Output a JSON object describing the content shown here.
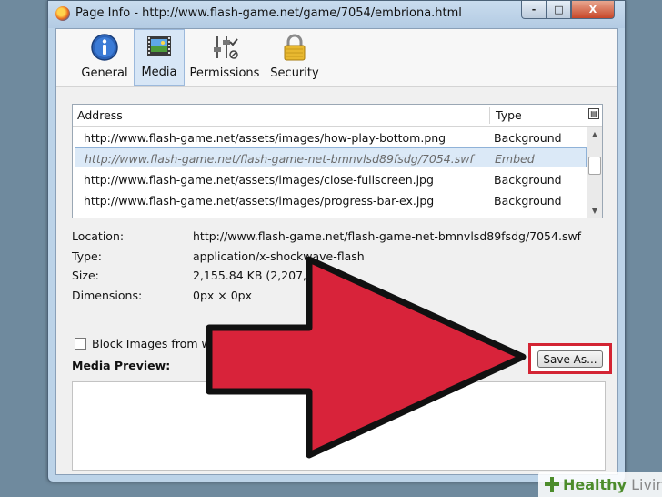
{
  "window": {
    "title": "Page Info - http://www.flash-game.net/game/7054/embriona.html",
    "controls": {
      "minimize": "-",
      "maximize": "□",
      "close": "X"
    }
  },
  "tabs": [
    {
      "label": "General",
      "icon": "info-icon"
    },
    {
      "label": "Media",
      "icon": "media-icon",
      "active": true
    },
    {
      "label": "Permissions",
      "icon": "permissions-icon"
    },
    {
      "label": "Security",
      "icon": "lock-icon"
    }
  ],
  "media_list": {
    "columns": {
      "address": "Address",
      "type": "Type"
    },
    "rows": [
      {
        "address": "http://www.flash-game.net/assets/images/how-play-bottom.png",
        "type": "Background"
      },
      {
        "address": "http://www.flash-game.net/flash-game-net-bmnvlsd89fsdg/7054.swf",
        "type": "Embed",
        "selected": true
      },
      {
        "address": "http://www.flash-game.net/assets/images/close-fullscreen.jpg",
        "type": "Background"
      },
      {
        "address": "http://www.flash-game.net/assets/images/progress-bar-ex.jpg",
        "type": "Background"
      }
    ]
  },
  "details": {
    "location": {
      "label": "Location:",
      "value": "http://www.flash-game.net/flash-game-net-bmnvlsd89fsdg/7054.swf"
    },
    "type": {
      "label": "Type:",
      "value": "application/x-shockwave-flash"
    },
    "size": {
      "label": "Size:",
      "value": "2,155.84 KB (2,207,57"
    },
    "dimensions": {
      "label": "Dimensions:",
      "value": "0px × 0px"
    }
  },
  "block_images": {
    "label": "Block Images from ww",
    "checked": false
  },
  "media_preview": {
    "label": "Media Preview:"
  },
  "save_button": {
    "label": "Save As..."
  },
  "annotation": {
    "arrow_color": "#d8233a",
    "highlight_color": "#d32433"
  },
  "watermark": {
    "part1": "Healthy",
    "part2": " Living"
  }
}
